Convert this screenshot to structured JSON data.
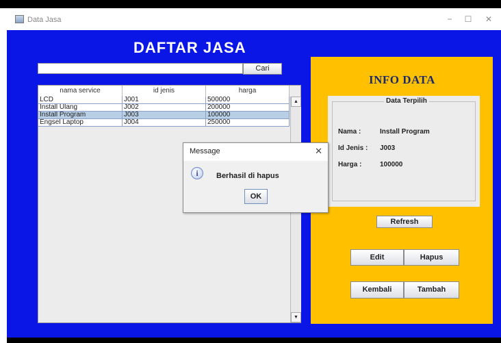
{
  "window": {
    "title": "Data Jasa",
    "icon": "app-window-icon",
    "controls": [
      "−",
      "☐",
      "✕"
    ]
  },
  "header": {
    "title": "DAFTAR JASA"
  },
  "search": {
    "value": "",
    "placeholder": "",
    "button_label": "Cari"
  },
  "table": {
    "columns": [
      "nama service",
      "id jenis",
      "harga"
    ],
    "rows": [
      {
        "nama_service": "LCD",
        "id_jenis": "J001",
        "harga": "500000",
        "selected": false
      },
      {
        "nama_service": "Install Ulang",
        "id_jenis": "J002",
        "harga": "200000",
        "selected": false
      },
      {
        "nama_service": "Install Program",
        "id_jenis": "J003",
        "harga": "100000",
        "selected": true
      },
      {
        "nama_service": "Engsel Laptop",
        "id_jenis": "J004",
        "harga": "250000",
        "selected": false
      }
    ]
  },
  "dialog": {
    "title": "Message",
    "message": "Berhasil di hapus",
    "ok_label": "OK",
    "icon": "info-icon"
  },
  "info": {
    "title": "INFO DATA",
    "group_label": "Data Terpilih",
    "nama_label": "Nama   :",
    "nama_value": "Install Program",
    "id_label": "Id Jenis :",
    "id_value": "J003",
    "harga_label": "Harga   :",
    "harga_value": "100000"
  },
  "buttons": {
    "refresh": "Refresh",
    "edit": "Edit",
    "hapus": "Hapus",
    "kembali": "Kembali",
    "tambah": "Tambah"
  },
  "colors": {
    "background": "#0a16e6",
    "info_panel": "#ffc000",
    "selected_row": "#b8cfe5"
  }
}
